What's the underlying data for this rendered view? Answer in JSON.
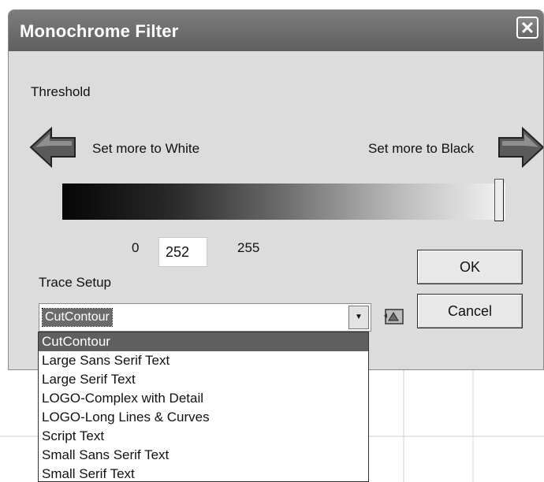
{
  "dialog": {
    "title": "Monochrome Filter",
    "close_glyph": "✕",
    "threshold_label": "Threshold",
    "white_label": "Set more to White",
    "black_label": "Set more to Black",
    "threshold": {
      "min": "0",
      "value": "252",
      "max": "255"
    },
    "trace_setup_label": "Trace Setup",
    "ok_label": "OK",
    "cancel_label": "Cancel",
    "combo_value": "CutContour",
    "combo_arrow_glyph": "▼"
  },
  "dropdown": {
    "items": [
      "CutContour",
      "Large Sans Serif Text",
      "Large Serif Text",
      "LOGO-Complex with Detail",
      "LOGO-Long Lines & Curves",
      "Script Text",
      "Small Sans Serif Text",
      "Small Serif Text"
    ],
    "selected_index": 0
  },
  "icons": {
    "left_arrow": "left-arrow-icon",
    "right_arrow": "right-arrow-icon",
    "trace_settings": "trace-settings-icon",
    "close": "close-icon"
  }
}
